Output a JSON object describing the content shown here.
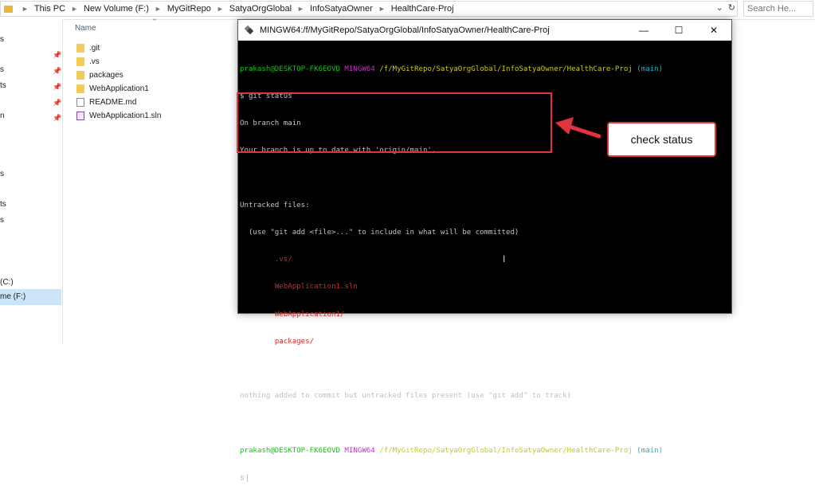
{
  "explorer": {
    "breadcrumbs": [
      "This PC",
      "New Volume (F:)",
      "MyGitRepo",
      "SatyaOrgGlobal",
      "InfoSatyaOwner",
      "HealthCare-Proj"
    ],
    "search_placeholder": "Search He...",
    "column_header": "Name",
    "files": [
      {
        "name": ".git",
        "type": "folder"
      },
      {
        "name": ".vs",
        "type": "folder"
      },
      {
        "name": "packages",
        "type": "folder"
      },
      {
        "name": "WebApplication1",
        "type": "folder"
      },
      {
        "name": "README.md",
        "type": "document"
      },
      {
        "name": "WebApplication1.sln",
        "type": "solution"
      }
    ],
    "nav_fragments": [
      "s",
      "s",
      "ts",
      "n",
      "s",
      "ts",
      "s",
      "(C:)",
      "me (F:)"
    ]
  },
  "terminal": {
    "title": "MINGW64:/f/MyGitRepo/SatyaOrgGlobal/InfoSatyaOwner/HealthCare-Proj",
    "prompt_user": "prakash@DESKTOP-FK6EOVD",
    "prompt_env": "MINGW64",
    "prompt_path": "/f/MyGitRepo/SatyaOrgGlobal/InfoSatyaOwner/HealthCare-Proj",
    "prompt_branch": "(main)",
    "command": "$ git status",
    "out_branch": "On branch main",
    "out_uptodate": "Your branch is up to date with 'origin/main'.",
    "untracked_header": "Untracked files:",
    "untracked_hint": "  (use \"git add <file>...\" to include in what will be committed)",
    "untracked_files": [
      ".vs/",
      "WebApplication1.sln",
      "WebApplication1/",
      "packages/"
    ],
    "nothing_added": "nothing added to commit but untracked files present (use \"git add\" to track)",
    "final_prompt": "$"
  },
  "annotation": {
    "callout_text": "check status",
    "color": "#e0333b"
  }
}
